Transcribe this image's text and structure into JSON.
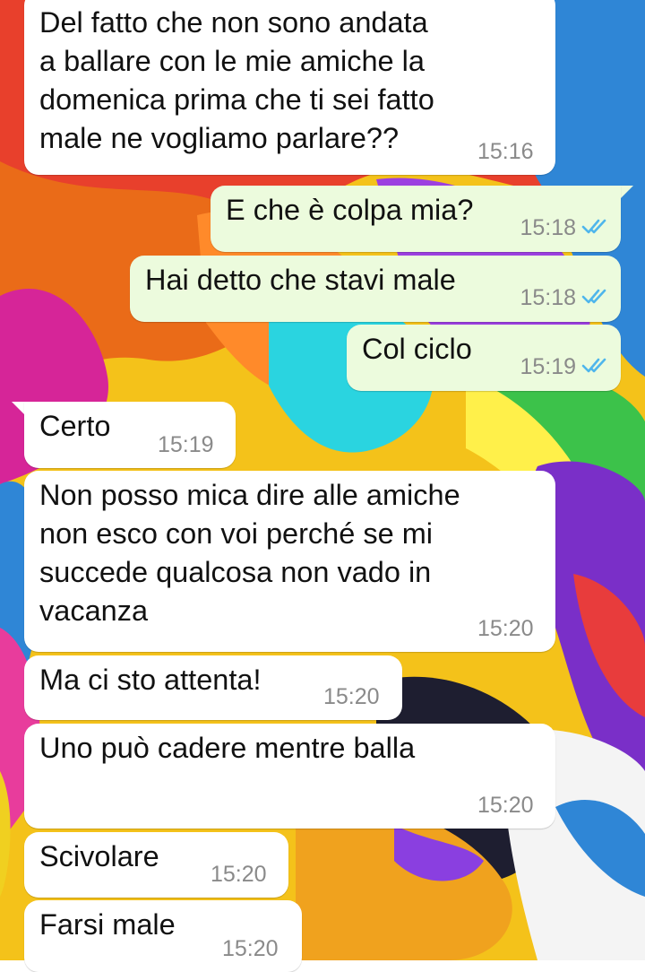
{
  "messages": [
    {
      "dir": "in",
      "text": "Del fatto che non sono andata\na ballare con le mie amiche la\ndomenica prima che ti sei fatto\nmale ne vogliamo parlare??",
      "time": "15:16"
    },
    {
      "dir": "out",
      "text": "E che è colpa mia?",
      "time": "15:18",
      "status": "read"
    },
    {
      "dir": "out",
      "text": "Hai detto che stavi male",
      "time": "15:18",
      "status": "read"
    },
    {
      "dir": "out",
      "text": "Col ciclo",
      "time": "15:19",
      "status": "read"
    },
    {
      "dir": "in",
      "text": "Certo",
      "time": "15:19"
    },
    {
      "dir": "in",
      "text": "Non posso mica dire alle amiche\nnon esco con voi perché se mi\nsuccede qualcosa non vado in\nvacanza",
      "time": "15:20"
    },
    {
      "dir": "in",
      "text": "Ma ci sto attenta!",
      "time": "15:20"
    },
    {
      "dir": "in",
      "text": "Uno può cadere mentre balla",
      "time": "15:20"
    },
    {
      "dir": "in",
      "text": "Scivolare",
      "time": "15:20"
    },
    {
      "dir": "in",
      "text": "Farsi male",
      "time": "15:20"
    }
  ],
  "colors": {
    "incoming_bubble": "#ffffff",
    "outgoing_bubble": "#ecfbdd",
    "timestamp": "#8a8a8a",
    "read_ticks": "#4fb6ec"
  },
  "icons": {
    "status_read": "double-check-icon"
  }
}
